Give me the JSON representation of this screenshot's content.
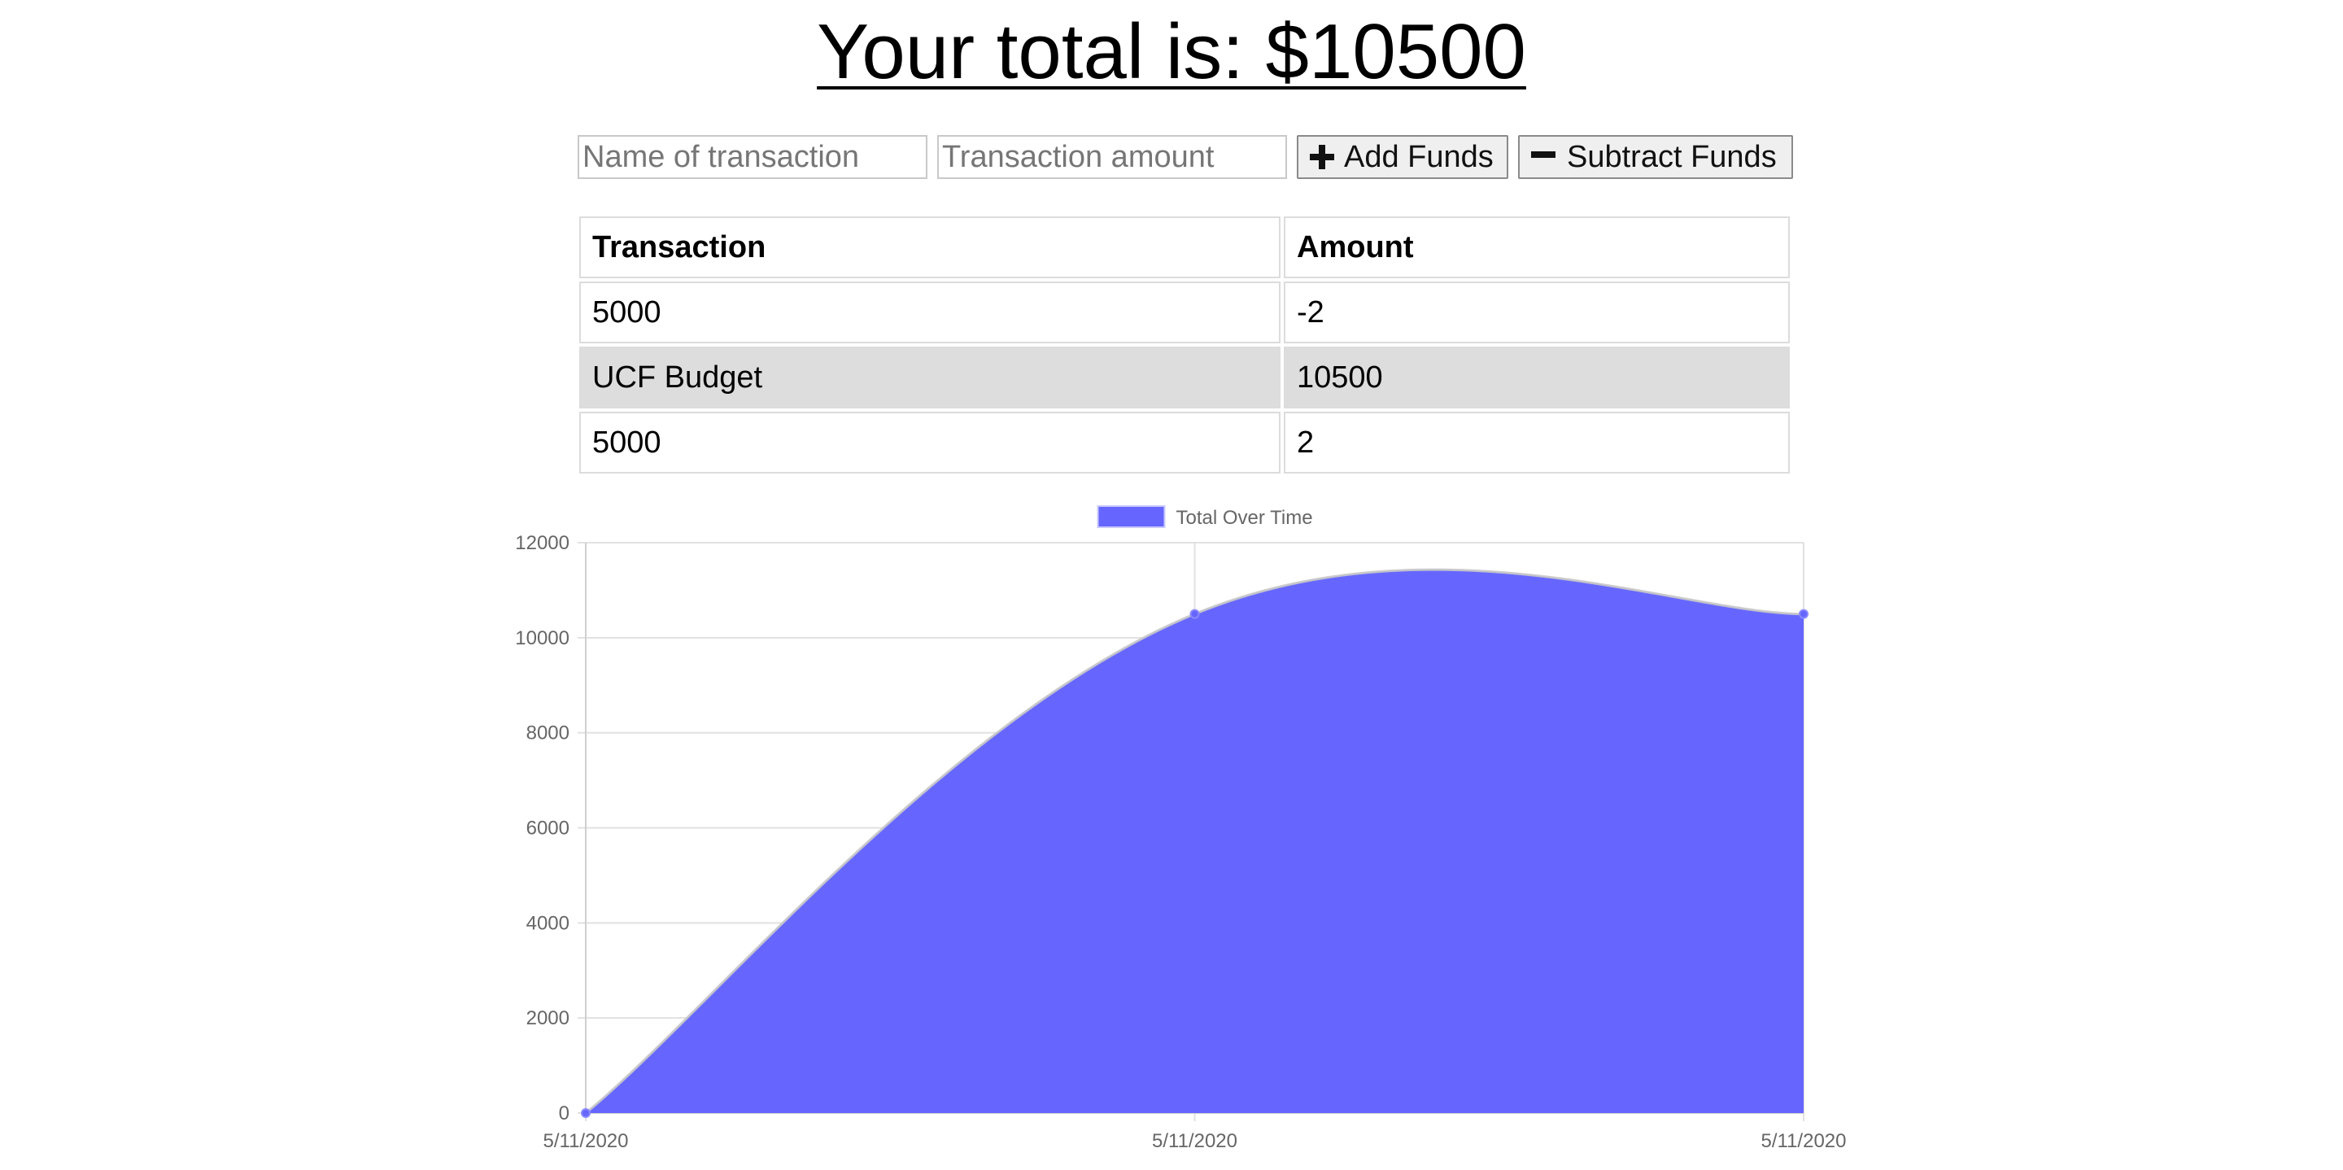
{
  "total": {
    "label": "Your total is: $10500"
  },
  "form": {
    "name_placeholder": "Name of transaction",
    "amount_placeholder": "Transaction amount",
    "add_label": "Add Funds",
    "subtract_label": "Subtract Funds",
    "add_icon": "plus-icon",
    "subtract_icon": "minus-icon"
  },
  "table": {
    "headers": [
      "Transaction",
      "Amount"
    ],
    "rows": [
      {
        "name": "5000",
        "amount": "-2"
      },
      {
        "name": "UCF Budget",
        "amount": "10500"
      },
      {
        "name": "5000",
        "amount": "2"
      }
    ]
  },
  "chart_data": {
    "type": "area",
    "title": "",
    "xlabel": "",
    "ylabel": "",
    "x": [
      "5/11/2020",
      "5/11/2020",
      "5/11/2020"
    ],
    "series": [
      {
        "name": "Total Over Time",
        "values": [
          0,
          10500,
          10500
        ],
        "color": "#6666ff"
      }
    ],
    "ylim": [
      0,
      12000
    ],
    "yticks": [
      0,
      2000,
      4000,
      6000,
      8000,
      10000,
      12000
    ],
    "grid": true,
    "legend": "top-center",
    "curve": "smooth"
  }
}
